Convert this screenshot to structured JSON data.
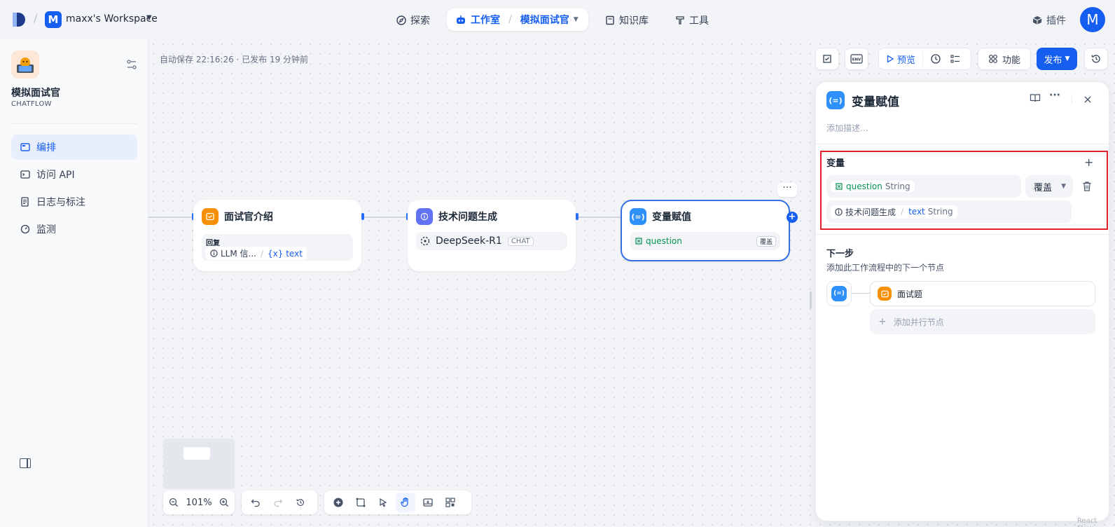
{
  "header": {
    "workspace_initial": "M",
    "workspace_name": "maxx's Workspace",
    "nav": {
      "explore": "探索",
      "studio": "工作室",
      "current_app": "模拟面试官",
      "knowledge": "知识库",
      "tools": "工具"
    },
    "plugins": "插件",
    "user_initial": "M"
  },
  "sidebar": {
    "app_name": "模拟面试官",
    "app_type": "CHATFLOW",
    "items": [
      {
        "label": "编排",
        "icon": "layout-icon",
        "active": true
      },
      {
        "label": "访问 API",
        "icon": "terminal-icon",
        "active": false
      },
      {
        "label": "日志与标注",
        "icon": "log-icon",
        "active": false
      },
      {
        "label": "监测",
        "icon": "gauge-icon",
        "active": false
      }
    ]
  },
  "canvas": {
    "autosave": "自动保存 22:16:26 · 已发布 19 分钟前",
    "toolbar": {
      "preview": "预览",
      "features": "功能",
      "publish": "发布"
    },
    "nodes": [
      {
        "title": "面试官介绍",
        "reply_label": "回复",
        "source": "LLM 信...",
        "var": "{x} text"
      },
      {
        "title": "技术问题生成",
        "model": "DeepSeek-R1",
        "tag": "CHAT"
      },
      {
        "title": "变量赋值",
        "var": "question",
        "mode": "覆盖"
      }
    ],
    "zoom": "101%"
  },
  "panel": {
    "title": "变量赋值",
    "description_placeholder": "添加描述...",
    "variables_title": "变量",
    "var_name": "question",
    "var_type": "String",
    "mode": "覆盖",
    "source_node": "技术问题生成",
    "source_var": "text",
    "source_type": "String",
    "next_step_title": "下一步",
    "next_step_sub": "添加此工作流程中的下一个节点",
    "next_node": "面试题",
    "add_parallel": "添加并行节点"
  },
  "watermark": "React Flow",
  "colors": {
    "accent": "#155eef",
    "highlight_box": "#e0202a"
  }
}
